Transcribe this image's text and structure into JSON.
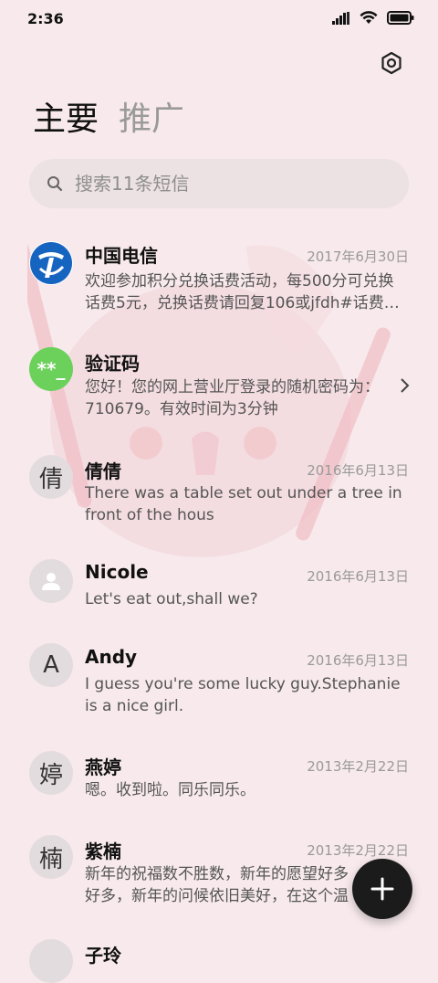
{
  "status": {
    "time": "2:36",
    "icons": [
      "signal-icon",
      "wifi-icon",
      "battery-icon"
    ]
  },
  "header": {
    "settings_icon": "gear-icon",
    "tabs": [
      {
        "label": "主要",
        "active": true
      },
      {
        "label": "推广",
        "active": false
      }
    ]
  },
  "search": {
    "placeholder": "搜索11条短信",
    "value": ""
  },
  "conversations": [
    {
      "sender": "中国电信",
      "date": "2017年6月30日",
      "preview": "欢迎参加积分兑换话费活动，每500分可兑换话费5元，兑换话费请回复106或jfdh#话费…",
      "avatar_type": "logo",
      "avatar_color": "#1565c0"
    },
    {
      "sender": "验证码",
      "date": "",
      "preview": "您好！您的网上营业厅登录的随机密码为：710679。有效时间为3分钟",
      "avatar_type": "text",
      "avatar_text": "**_",
      "avatar_color": "#6bd15a",
      "has_chevron": true
    },
    {
      "sender": "倩倩",
      "date": "2016年6月13日",
      "preview": "There was a table set out under a tree in front of the hous",
      "avatar_type": "text",
      "avatar_text": "倩"
    },
    {
      "sender": "Nicole",
      "date": "2016年6月13日",
      "preview": "Let's eat out,shall we?",
      "avatar_type": "person-icon"
    },
    {
      "sender": "Andy",
      "date": "2016年6月13日",
      "preview": "I guess you're some lucky guy.Stephanie is a nice girl.",
      "avatar_type": "text",
      "avatar_text": "A"
    },
    {
      "sender": "燕婷",
      "date": "2013年2月22日",
      "preview": "嗯。收到啦。同乐同乐。",
      "avatar_type": "text",
      "avatar_text": "婷"
    },
    {
      "sender": "紫楠",
      "date": "2013年2月22日",
      "preview": "新年的祝福数不胜数，新年的愿望好多好多，新年的问候依旧美好，在这个温馨的时刻…",
      "avatar_type": "text",
      "avatar_text": "楠"
    },
    {
      "sender": "子玲",
      "date": "",
      "preview": "",
      "avatar_type": "text",
      "avatar_text": ""
    }
  ],
  "fab": {
    "icon": "plus-icon"
  },
  "colors": {
    "background": "#f7e9ec",
    "search_bg": "#ece1e3",
    "fab_bg": "#1b1b1b",
    "verify_green": "#6bd15a",
    "telecom_blue": "#1565c0"
  }
}
